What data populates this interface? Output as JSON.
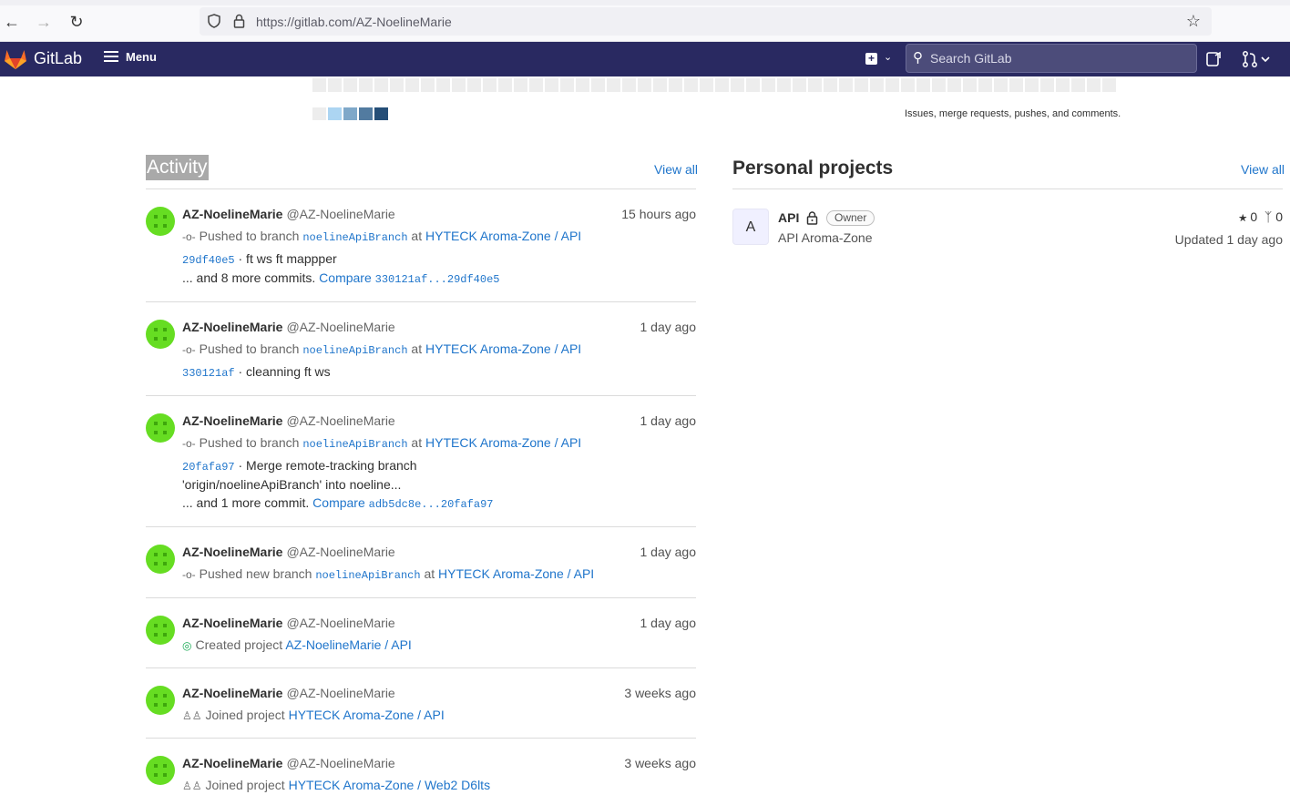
{
  "browser": {
    "url": "https://gitlab.com/AZ-NoelineMarie"
  },
  "header": {
    "brand": "GitLab",
    "menu_label": "Menu",
    "search_placeholder": "Search GitLab"
  },
  "calendar": {
    "legend_text": "Issues, merge requests, pushes, and comments.",
    "legend_colors": [
      "#ededed",
      "#acd5f2",
      "#7fa8c9",
      "#527ba0",
      "#254e77"
    ]
  },
  "activity": {
    "title": "Activity",
    "view_all": "View all",
    "events": [
      {
        "name": "AZ-NoelineMarie",
        "handle": "@AZ-NoelineMarie",
        "time": "15 hours ago",
        "action": "Pushed to branch",
        "branch": "noelineApiBranch",
        "at": "at",
        "project": "HYTECK Aroma-Zone / API",
        "commit_sha": "29df40e5",
        "commit_msg": "· ft ws ft mappper",
        "more": "... and 8 more commits.",
        "compare_label": "Compare",
        "compare_range": "330121af...29df40e5"
      },
      {
        "name": "AZ-NoelineMarie",
        "handle": "@AZ-NoelineMarie",
        "time": "1 day ago",
        "action": "Pushed to branch",
        "branch": "noelineApiBranch",
        "at": "at",
        "project": "HYTECK Aroma-Zone / API",
        "commit_sha": "330121af",
        "commit_msg": "· cleanning ft ws"
      },
      {
        "name": "AZ-NoelineMarie",
        "handle": "@AZ-NoelineMarie",
        "time": "1 day ago",
        "action": "Pushed to branch",
        "branch": "noelineApiBranch",
        "at": "at",
        "project": "HYTECK Aroma-Zone / API",
        "commit_sha": "20fafa97",
        "commit_msg": "· Merge remote-tracking branch",
        "commit_msg2": "'origin/noelineApiBranch' into noeline...",
        "more": "... and 1 more commit.",
        "compare_label": "Compare",
        "compare_range": "adb5dc8e...20fafa97"
      },
      {
        "name": "AZ-NoelineMarie",
        "handle": "@AZ-NoelineMarie",
        "time": "1 day ago",
        "action": "Pushed new branch",
        "branch": "noelineApiBranch",
        "at": "at",
        "project": "HYTECK Aroma-Zone / API"
      },
      {
        "name": "AZ-NoelineMarie",
        "handle": "@AZ-NoelineMarie",
        "time": "1 day ago",
        "action": "Created project",
        "project": "AZ-NoelineMarie / API"
      },
      {
        "name": "AZ-NoelineMarie",
        "handle": "@AZ-NoelineMarie",
        "time": "3 weeks ago",
        "action": "Joined project",
        "project": "HYTECK Aroma-Zone / API"
      },
      {
        "name": "AZ-NoelineMarie",
        "handle": "@AZ-NoelineMarie",
        "time": "3 weeks ago",
        "action": "Joined project",
        "project": "HYTECK Aroma-Zone / Web2 D6lts"
      }
    ]
  },
  "projects": {
    "title": "Personal projects",
    "view_all": "View all",
    "items": [
      {
        "avatar_letter": "A",
        "name": "API",
        "badge": "Owner",
        "description": "API Aroma-Zone",
        "stars": "0",
        "forks": "0",
        "updated": "Updated 1 day ago"
      }
    ]
  }
}
